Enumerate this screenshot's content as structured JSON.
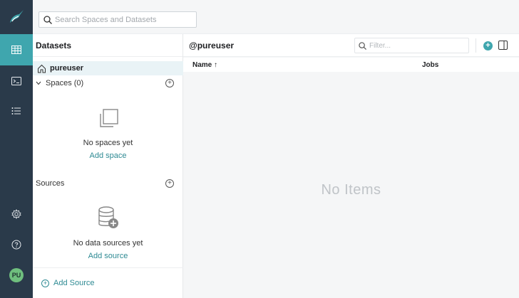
{
  "topbar": {
    "search_placeholder": "Search Spaces and Datasets"
  },
  "rail": {
    "items": [
      {
        "name": "datasets",
        "icon": "grid-icon",
        "active": true
      },
      {
        "name": "sql-runner",
        "icon": "terminal-icon",
        "active": false
      },
      {
        "name": "jobs",
        "icon": "list-icon",
        "active": false
      }
    ],
    "bottom": [
      {
        "name": "settings",
        "icon": "gear-icon"
      },
      {
        "name": "help",
        "icon": "help-icon"
      }
    ],
    "avatar": "PU"
  },
  "panel": {
    "title": "Datasets",
    "home": "pureuser",
    "spaces_label": "Spaces (0)",
    "spaces_empty": "No spaces yet",
    "add_space": "Add space",
    "sources_label": "Sources",
    "sources_empty": "No data sources yet",
    "add_source_link": "Add source",
    "add_source_button": "Add Source"
  },
  "main": {
    "title": "@pureuser",
    "filter_placeholder": "Filter...",
    "columns": {
      "name": "Name ↑",
      "jobs": "Jobs"
    },
    "empty": "No Items"
  },
  "colors": {
    "rail": "#2a3a4a",
    "accent": "#3fa6ae",
    "link": "#2e8a93"
  }
}
